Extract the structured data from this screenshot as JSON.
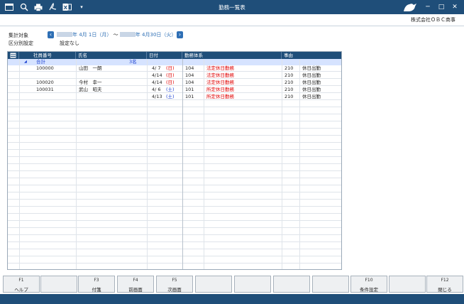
{
  "window": {
    "title": "勤務一覧表",
    "company": "株式会社ＯＢＣ商事",
    "controls": {
      "minimize": "─",
      "maximize": "□",
      "close": "✕"
    }
  },
  "toolbar": {
    "icons": [
      "window-icon",
      "search-icon",
      "print-icon",
      "pdf-icon",
      "excel-icon",
      "dropdown-icon"
    ]
  },
  "conditions": {
    "period_label": "集計対象",
    "period_start": "年 4月 1日（月）",
    "period_tilde": "～",
    "period_end": "年 4月30日（火）",
    "section_label": "区分別設定",
    "section_value": "設定なし"
  },
  "grid": {
    "headers": {
      "employee_no": "社員番号",
      "name": "氏名",
      "date": "日付",
      "work_system": "勤務体系",
      "reason": "事由"
    },
    "total": {
      "label": "合計",
      "count": "3名"
    },
    "rows": [
      {
        "emp_no": "100000",
        "name": "山田　一朗",
        "date": "4/ 7",
        "weekday": "(日)",
        "wday_type": "sun",
        "ws_code": "104",
        "ws_name": "法定休日勤務",
        "reason_code": "210",
        "reason_name": "休日出勤"
      },
      {
        "emp_no": "",
        "name": "",
        "date": "4/14",
        "weekday": "(日)",
        "wday_type": "sun",
        "ws_code": "104",
        "ws_name": "法定休日勤務",
        "reason_code": "210",
        "reason_name": "休日出勤"
      },
      {
        "emp_no": "100020",
        "name": "今村　幸一",
        "date": "4/14",
        "weekday": "(日)",
        "wday_type": "sun",
        "ws_code": "104",
        "ws_name": "法定休日勤務",
        "reason_code": "210",
        "reason_name": "休日出勤"
      },
      {
        "emp_no": "100031",
        "name": "武山　昭夫",
        "date": "4/ 6",
        "weekday": "(土)",
        "wday_type": "sat",
        "ws_code": "101",
        "ws_name": "所定休日勤務",
        "reason_code": "210",
        "reason_name": "休日出勤"
      },
      {
        "emp_no": "",
        "name": "",
        "date": "4/13",
        "weekday": "(土)",
        "wday_type": "sat",
        "ws_code": "101",
        "ws_name": "所定休日勤務",
        "reason_code": "210",
        "reason_name": "休日出勤"
      }
    ]
  },
  "fkeys": [
    {
      "num": "F1",
      "label": "ヘルプ"
    },
    {
      "num": "",
      "label": ""
    },
    {
      "num": "F3",
      "label": "付箋"
    },
    {
      "num": "F4",
      "label": "前画面"
    },
    {
      "num": "F5",
      "label": "次画面"
    },
    {
      "num": "",
      "label": ""
    },
    {
      "num": "",
      "label": ""
    },
    {
      "num": "",
      "label": ""
    },
    {
      "num": "",
      "label": ""
    },
    {
      "num": "F10",
      "label": "条件設定"
    },
    {
      "num": "",
      "label": ""
    },
    {
      "num": "F12",
      "label": "閉じる"
    }
  ],
  "colors": {
    "titlebar": "#1f4e79",
    "total_row": "#d6e3ff",
    "sunday": "#e00000",
    "saturday": "#1a3fd0",
    "accent": "#2e6fb5"
  }
}
